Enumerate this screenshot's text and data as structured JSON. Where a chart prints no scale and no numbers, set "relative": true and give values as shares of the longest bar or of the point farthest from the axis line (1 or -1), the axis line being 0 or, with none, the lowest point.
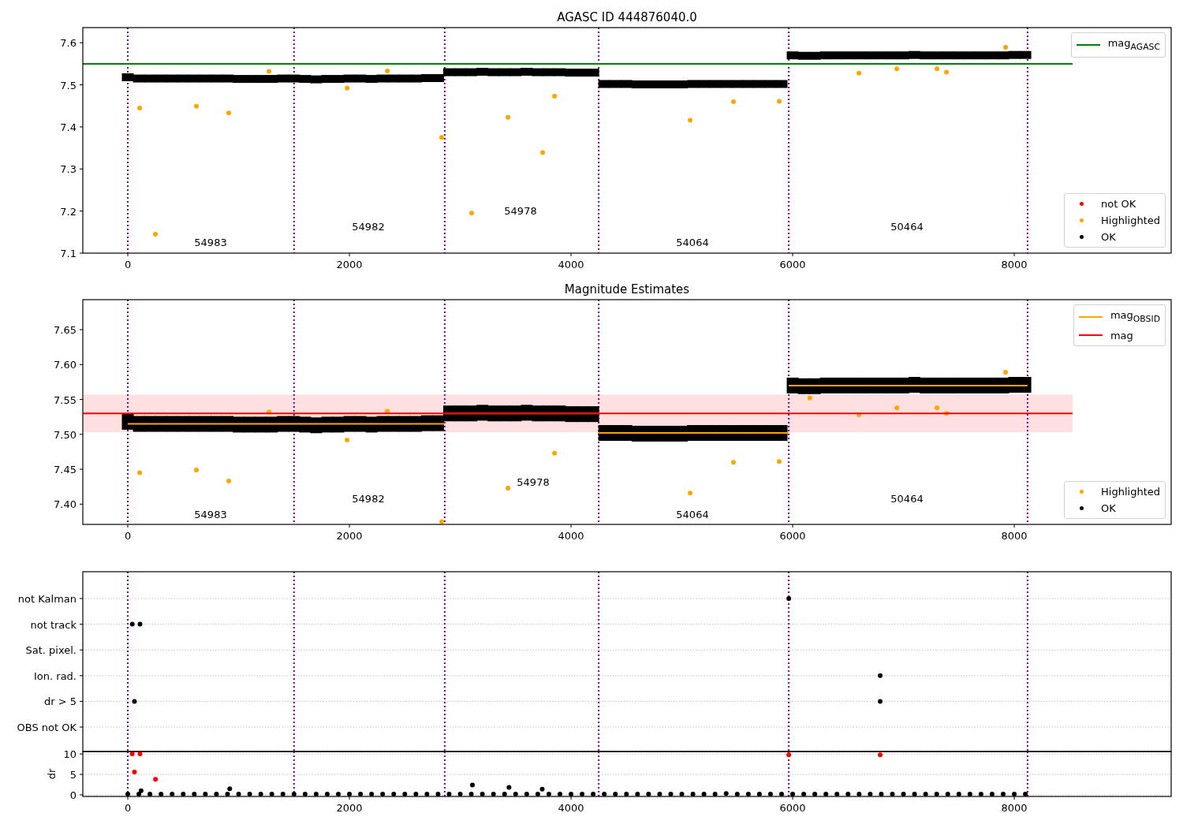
{
  "panels": [
    {
      "chart_data": {
        "type": "scatter",
        "title": "AGASC ID 444876040.0",
        "xlim": [
          -406,
          9416
        ],
        "ylim": [
          7.1,
          7.636
        ],
        "xticks": [
          0,
          2000,
          4000,
          6000,
          8000
        ],
        "yticks": [
          7.1,
          7.2,
          7.3,
          7.4,
          7.5,
          7.6
        ],
        "series": [
          {
            "name": "mag$_{AGASC}$",
            "type": "line",
            "color": "#008000",
            "x": [
              -406,
              8527
            ],
            "values": [
              7.55,
              7.55
            ]
          },
          {
            "name": "not OK",
            "type": "scatter",
            "color": "#ff0000",
            "x": [
              null
            ],
            "values": [
              null
            ]
          },
          {
            "name": "Highlighted",
            "type": "scatter",
            "color": "#ffa500",
            "x": [
              107,
              249,
              619,
              911,
              1274,
              1979,
              2342,
              2833,
              3103,
              3431,
              3744,
              3851,
              5075,
              5466,
              5879,
              6598,
              6940,
              7303,
              7388,
              7922
            ],
            "values": [
              7.445,
              7.145,
              7.449,
              7.433,
              7.532,
              7.492,
              7.533,
              7.375,
              7.195,
              7.423,
              7.339,
              7.473,
              7.416,
              7.46,
              7.461,
              7.528,
              7.538,
              7.538,
              7.53,
              7.589
            ]
          },
          {
            "name": "OK",
            "type": "scatter",
            "color": "#000000",
            "x": [
              0,
              100,
              200,
              300,
              400,
              500,
              600,
              700,
              800,
              900,
              1000,
              1100,
              1200,
              1300,
              1400,
              1500,
              1600,
              1700,
              1800,
              1900,
              2000,
              2100,
              2200,
              2300,
              2400,
              2500,
              2600,
              2700,
              2800,
              2900,
              3000,
              3100,
              3200,
              3300,
              3400,
              3500,
              3600,
              3700,
              3800,
              3900,
              4000,
              4100,
              4200,
              4300,
              4400,
              4500,
              4600,
              4700,
              4800,
              4900,
              5000,
              5100,
              5200,
              5300,
              5400,
              5500,
              5600,
              5700,
              5800,
              5900,
              6000,
              6100,
              6200,
              6300,
              6400,
              6500,
              6600,
              6700,
              6800,
              6900,
              7000,
              7100,
              7200,
              7300,
              7400,
              7500,
              7600,
              7700,
              7800,
              7900,
              8000,
              8100
            ],
            "values": [
              7.518,
              7.515,
              7.515,
              7.515,
              7.515,
              7.515,
              7.515,
              7.515,
              7.515,
              7.515,
              7.514,
              7.514,
              7.514,
              7.514,
              7.515,
              7.515,
              7.514,
              7.513,
              7.514,
              7.514,
              7.515,
              7.515,
              7.514,
              7.515,
              7.515,
              7.515,
              7.515,
              7.516,
              7.516,
              7.53,
              7.53,
              7.53,
              7.531,
              7.53,
              7.53,
              7.53,
              7.531,
              7.53,
              7.53,
              7.53,
              7.529,
              7.529,
              7.529,
              7.502,
              7.502,
              7.502,
              7.501,
              7.501,
              7.501,
              7.501,
              7.501,
              7.502,
              7.502,
              7.502,
              7.502,
              7.502,
              7.502,
              7.502,
              7.502,
              7.502,
              7.57,
              7.569,
              7.569,
              7.57,
              7.57,
              7.57,
              7.57,
              7.57,
              7.57,
              7.57,
              7.57,
              7.571,
              7.57,
              7.57,
              7.57,
              7.57,
              7.57,
              7.57,
              7.57,
              7.57,
              7.571,
              7.571
            ]
          }
        ],
        "ref_lines": [
          {
            "axis": "x",
            "value": 0
          },
          {
            "axis": "x",
            "value": 1500
          },
          {
            "axis": "x",
            "value": 2860
          },
          {
            "axis": "x",
            "value": 4250
          },
          {
            "axis": "x",
            "value": 5965
          },
          {
            "axis": "x",
            "value": 8120
          }
        ],
        "annotations": [
          "54983",
          "54982",
          "54978",
          "54064",
          "50464"
        ]
      }
    },
    {
      "chart_data": {
        "type": "scatter",
        "title": "Magnitude Estimates",
        "xlim": [
          -406,
          9416
        ],
        "ylim": [
          7.371,
          7.693
        ],
        "xticks": [
          0,
          2000,
          4000,
          6000,
          8000
        ],
        "yticks": [
          {
            "value": 7.4,
            "label": "7.40"
          },
          {
            "value": 7.45,
            "label": "7.45"
          },
          {
            "value": 7.5,
            "label": "7.50"
          },
          {
            "value": 7.55,
            "label": "7.55"
          },
          {
            "value": 7.6,
            "label": "7.60"
          },
          {
            "value": 7.65,
            "label": "7.65"
          }
        ],
        "series": [
          {
            "name": "mag$_{OBSID}$",
            "type": "line",
            "color": "#ffa500",
            "x": [
              0,
              2860,
              null,
              2860,
              4250,
              null,
              4250,
              5965,
              null,
              5965,
              8120
            ],
            "values": [
              7.515,
              7.515,
              null,
              7.53,
              7.53,
              null,
              7.502,
              7.502,
              null,
              7.57,
              7.57
            ]
          },
          {
            "name": "mag",
            "type": "line",
            "color": "#ff0000",
            "x": [
              -406,
              8527
            ],
            "values": [
              7.53,
              7.53
            ]
          },
          {
            "name": "Highlighted",
            "type": "scatter",
            "color": "#ffa500",
            "x": [
              107,
              619,
              911,
              1274,
              1979,
              2342,
              2833,
              3431,
              3851,
              5075,
              5466,
              5879,
              6155,
              6598,
              6940,
              7303,
              7388,
              7922
            ],
            "values": [
              7.445,
              7.449,
              7.433,
              7.532,
              7.492,
              7.533,
              7.375,
              7.423,
              7.473,
              7.416,
              7.46,
              7.461,
              7.552,
              7.528,
              7.538,
              7.538,
              7.53,
              7.589
            ]
          },
          {
            "name": "OK",
            "type": "scatter",
            "color": "#000000",
            "x": [
              0,
              100,
              200,
              300,
              400,
              500,
              600,
              700,
              800,
              900,
              1000,
              1100,
              1200,
              1300,
              1400,
              1500,
              1600,
              1700,
              1800,
              1900,
              2000,
              2100,
              2200,
              2300,
              2400,
              2500,
              2600,
              2700,
              2800,
              2900,
              3000,
              3100,
              3200,
              3300,
              3400,
              3500,
              3600,
              3700,
              3800,
              3900,
              4000,
              4100,
              4200,
              4300,
              4400,
              4500,
              4600,
              4700,
              4800,
              4900,
              5000,
              5100,
              5200,
              5300,
              5400,
              5500,
              5600,
              5700,
              5800,
              5900,
              6000,
              6100,
              6200,
              6300,
              6400,
              6500,
              6600,
              6700,
              6800,
              6900,
              7000,
              7100,
              7200,
              7300,
              7400,
              7500,
              7600,
              7700,
              7800,
              7900,
              8000,
              8100
            ],
            "values": [
              7.518,
              7.515,
              7.515,
              7.515,
              7.515,
              7.515,
              7.515,
              7.515,
              7.515,
              7.515,
              7.514,
              7.514,
              7.514,
              7.514,
              7.515,
              7.515,
              7.514,
              7.513,
              7.514,
              7.514,
              7.515,
              7.515,
              7.514,
              7.515,
              7.515,
              7.515,
              7.515,
              7.516,
              7.516,
              7.53,
              7.53,
              7.53,
              7.531,
              7.53,
              7.53,
              7.53,
              7.531,
              7.53,
              7.53,
              7.53,
              7.529,
              7.529,
              7.529,
              7.502,
              7.502,
              7.502,
              7.501,
              7.501,
              7.501,
              7.501,
              7.501,
              7.502,
              7.502,
              7.502,
              7.502,
              7.502,
              7.502,
              7.502,
              7.502,
              7.502,
              7.57,
              7.569,
              7.569,
              7.57,
              7.57,
              7.57,
              7.57,
              7.57,
              7.57,
              7.57,
              7.57,
              7.571,
              7.57,
              7.57,
              7.57,
              7.57,
              7.57,
              7.57,
              7.57,
              7.57,
              7.571,
              7.571
            ]
          }
        ],
        "bands": [
          {
            "axis": "y",
            "from": 7.503,
            "to": 7.557
          }
        ],
        "ref_lines": [
          {
            "axis": "x",
            "value": 0
          },
          {
            "axis": "x",
            "value": 1500
          },
          {
            "axis": "x",
            "value": 2860
          },
          {
            "axis": "x",
            "value": 4250
          },
          {
            "axis": "x",
            "value": 5965
          },
          {
            "axis": "x",
            "value": 8120
          }
        ],
        "annotations": [
          "54983",
          "54982",
          "54978",
          "54064",
          "50464"
        ]
      }
    },
    {
      "chart_data": {
        "type": "scatter",
        "relative": true,
        "orientation": "horizontal",
        "grid": true,
        "xlim": [
          -406,
          9416
        ],
        "categories": [
          "not Kalman",
          "not track",
          "Sat. pixel.",
          "Ion. rad.",
          "dr > 5",
          "OBS not OK"
        ],
        "series": [
          {
            "color": "#000000",
            "values": [
              5965,
              40,
              null,
              6790,
              60,
              null
            ]
          },
          {
            "color": "#000000",
            "values": [
              null,
              110,
              null,
              null,
              6790,
              null
            ]
          }
        ],
        "ref_lines": [
          {
            "axis": "x",
            "value": 0
          },
          {
            "axis": "x",
            "value": 1500
          },
          {
            "axis": "x",
            "value": 2860
          },
          {
            "axis": "x",
            "value": 4250
          },
          {
            "axis": "x",
            "value": 5965
          },
          {
            "axis": "x",
            "value": 8120
          }
        ]
      }
    },
    {
      "chart_data": {
        "type": "scatter",
        "ylabel": "dr",
        "grid": true,
        "xlim": [
          -406,
          9416
        ],
        "ylim": [
          -0.4,
          10.6
        ],
        "xticks": [
          0,
          2000,
          4000,
          6000,
          8000
        ],
        "yticks": [
          0,
          5,
          10
        ],
        "series": [
          {
            "color": "#000000",
            "x": [
              0,
              100,
              200,
              300,
              400,
              500,
              600,
              700,
              800,
              900,
              1000,
              1100,
              1200,
              1300,
              1400,
              1500,
              1600,
              1700,
              1800,
              1900,
              2000,
              2100,
              2200,
              2300,
              2400,
              2500,
              2600,
              2700,
              2800,
              2900,
              3000,
              3100,
              3200,
              3300,
              3400,
              3500,
              3600,
              3700,
              3800,
              3900,
              4000,
              4100,
              4200,
              4300,
              4400,
              4500,
              4600,
              4700,
              4800,
              4900,
              5000,
              5100,
              5200,
              5300,
              5400,
              5500,
              5600,
              5700,
              5800,
              5900,
              6000,
              6100,
              6200,
              6300,
              6400,
              6500,
              6600,
              6700,
              6800,
              6900,
              7000,
              7100,
              7200,
              7300,
              7400,
              7500,
              7600,
              7700,
              7800,
              7900,
              8000,
              8100,
              120,
              920,
              3110,
              3440,
              3740
            ],
            "values": [
              0.2,
              0.2,
              0.2,
              0.2,
              0.2,
              0.2,
              0.2,
              0.2,
              0.2,
              0.2,
              0.2,
              0.2,
              0.2,
              0.2,
              0.2,
              0.2,
              0.2,
              0.2,
              0.2,
              0.2,
              0.2,
              0.2,
              0.2,
              0.2,
              0.2,
              0.2,
              0.2,
              0.2,
              0.2,
              0.2,
              0.2,
              0.2,
              0.2,
              0.2,
              0.2,
              0.2,
              0.2,
              0.2,
              0.2,
              0.2,
              0.2,
              0.2,
              0.2,
              0.2,
              0.2,
              0.2,
              0.2,
              0.2,
              0.2,
              0.2,
              0.2,
              0.2,
              0.2,
              0.2,
              0.3,
              0.2,
              0.2,
              0.2,
              0.2,
              0.2,
              0.2,
              0.2,
              0.2,
              0.2,
              0.2,
              0.2,
              0.2,
              0.2,
              0.2,
              0.2,
              0.2,
              0.2,
              0.2,
              0.2,
              0.2,
              0.2,
              0.2,
              0.2,
              0.2,
              0.2,
              0.2,
              0.2,
              1.0,
              1.5,
              2.4,
              1.8,
              1.4
            ]
          },
          {
            "color": "#ff0000",
            "x": [
              40,
              110,
              60,
              250,
              5965,
              6790
            ],
            "values": [
              10,
              10,
              5.6,
              3.8,
              9.8,
              9.8
            ]
          }
        ],
        "ref_lines": [
          {
            "axis": "x",
            "value": 0
          },
          {
            "axis": "x",
            "value": 1500
          },
          {
            "axis": "x",
            "value": 2860
          },
          {
            "axis": "x",
            "value": 4250
          },
          {
            "axis": "x",
            "value": 5965
          },
          {
            "axis": "x",
            "value": 8120
          }
        ]
      }
    }
  ]
}
